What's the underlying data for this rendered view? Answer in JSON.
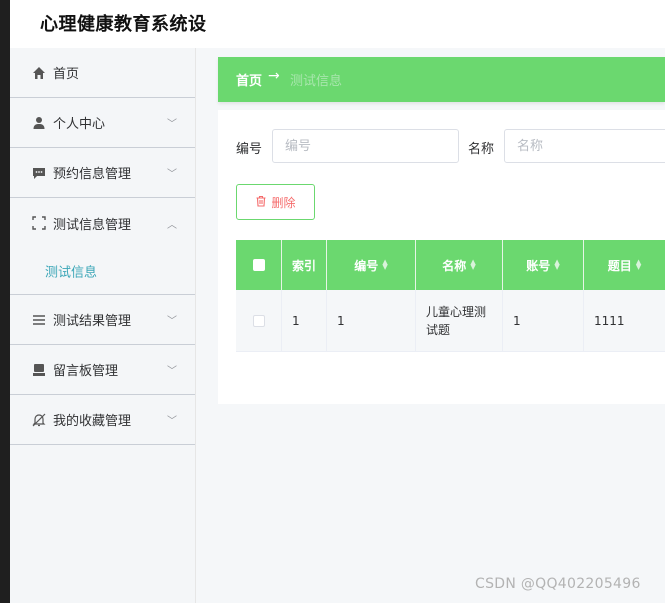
{
  "app": {
    "title": "心理健康教育系统设"
  },
  "sidebar": {
    "items": [
      {
        "label": "首页",
        "icon": "home-icon"
      },
      {
        "label": "个人中心",
        "icon": "user-icon",
        "expanded": false
      },
      {
        "label": "预约信息管理",
        "icon": "message-icon",
        "expanded": false
      },
      {
        "label": "测试信息管理",
        "icon": "fullscreen-icon",
        "expanded": true,
        "children": [
          {
            "label": "测试信息",
            "active": true
          }
        ]
      },
      {
        "label": "测试结果管理",
        "icon": "list-icon",
        "expanded": false
      },
      {
        "label": "留言板管理",
        "icon": "monitor-icon",
        "expanded": false
      },
      {
        "label": "我的收藏管理",
        "icon": "bell-off-icon",
        "expanded": false
      }
    ]
  },
  "breadcrumb": {
    "home": "首页",
    "separator": "→",
    "current": "测试信息"
  },
  "search": {
    "bianhao_label": "编号",
    "bianhao_placeholder": "编号",
    "mingcheng_label": "名称",
    "mingcheng_placeholder": "名称"
  },
  "actions": {
    "delete_label": "删除"
  },
  "table": {
    "columns": [
      "索引",
      "编号",
      "名称",
      "账号",
      "题目"
    ],
    "rows": [
      {
        "index": "1",
        "bianhao": "1",
        "mingcheng": "儿童心理测试题",
        "zhanghao": "1",
        "timu": "1111"
      }
    ]
  },
  "colors": {
    "accent": "#6bd86f",
    "active_link": "#3aa6b7",
    "danger": "#f56c6c"
  },
  "watermark": "CSDN @QQ402205496"
}
